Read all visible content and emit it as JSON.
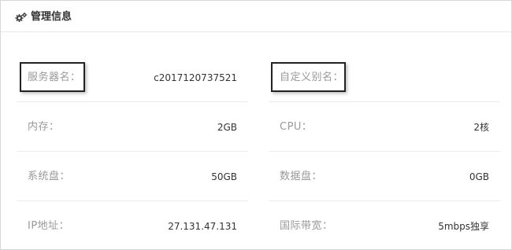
{
  "header": {
    "title": "管理信息",
    "icon": "gears-icon"
  },
  "left_column": [
    {
      "label": "服务器名：",
      "value": "c2017120737521"
    },
    {
      "label": "内存：",
      "value": "2GB"
    },
    {
      "label": "系统盘：",
      "value": "50GB"
    },
    {
      "label": "IP地址：",
      "value": "27.131.47.131"
    }
  ],
  "right_column": [
    {
      "label": "自定义别名：",
      "value": ""
    },
    {
      "label": "CPU：",
      "value": "2核"
    },
    {
      "label": "数据盘：",
      "value": "0GB"
    },
    {
      "label": "国际带宽：",
      "value": "5mbps独享"
    }
  ]
}
